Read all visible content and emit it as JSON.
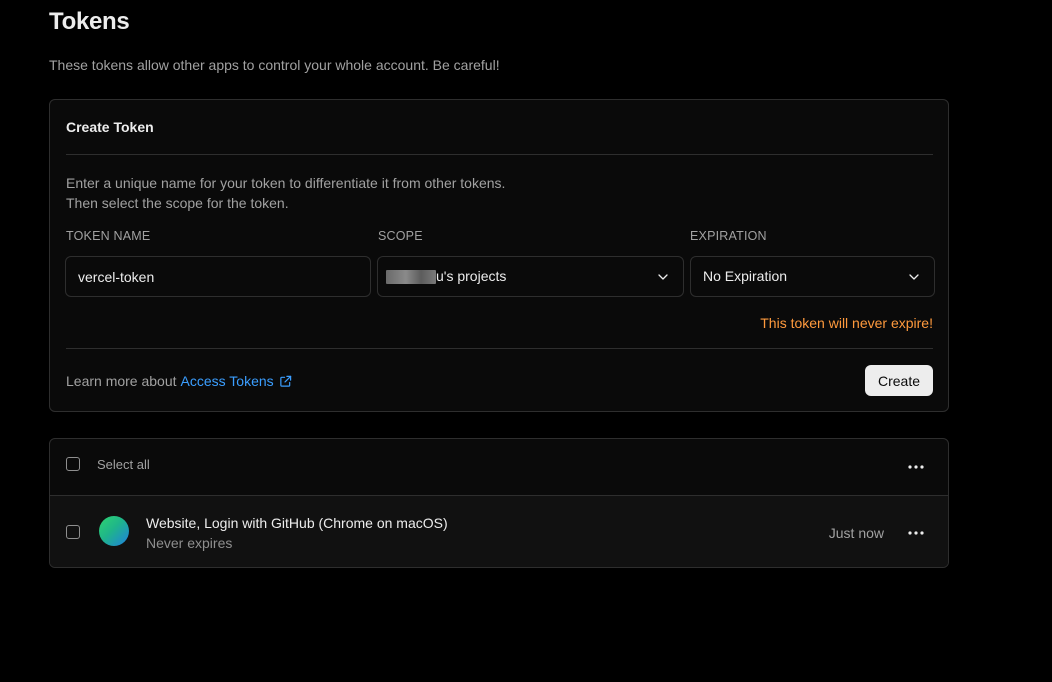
{
  "page": {
    "title": "Tokens",
    "subtitle": "These tokens allow other apps to control your whole account. Be careful!"
  },
  "create_token": {
    "title": "Create Token",
    "description_line1": "Enter a unique name for your token to differentiate it from other tokens.",
    "description_line2": "Then select the scope for the token.",
    "token_name": {
      "label": "TOKEN NAME",
      "value": "vercel-token"
    },
    "scope": {
      "label": "SCOPE",
      "value": "u's projects"
    },
    "expiration": {
      "label": "EXPIRATION",
      "value": "No Expiration"
    },
    "warning": "This token will never expire!",
    "learn_more_prefix": "Learn more about",
    "learn_more_link": "Access Tokens",
    "create_button": "Create"
  },
  "token_list": {
    "select_all_label": "Select all",
    "tokens": [
      {
        "name": "Website, Login with GitHub (Chrome on macOS)",
        "expiry": "Never expires",
        "created": "Just now"
      }
    ]
  },
  "colors": {
    "background": "#000000",
    "card": "#0a0a0a",
    "border": "#2e2e2e",
    "warning": "#ff9a3d",
    "link": "#3b9eff",
    "button_bg": "#ededed"
  },
  "icons": {
    "scope_dropdown": "chevron-down-icon",
    "expiration_dropdown": "chevron-down-icon",
    "external_link": "external-link-icon",
    "more": "more-horizontal-icon"
  }
}
